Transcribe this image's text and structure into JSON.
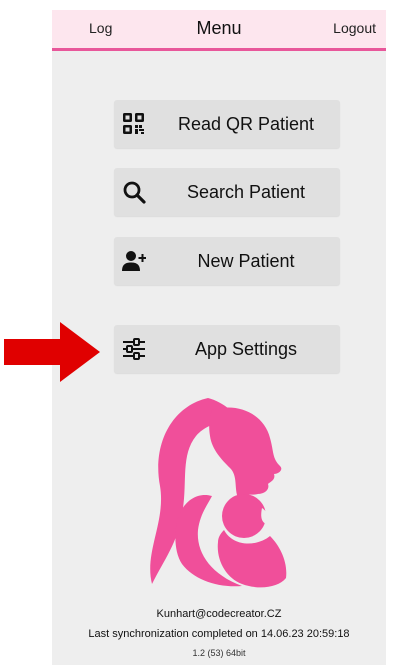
{
  "header": {
    "log_label": "Log",
    "title": "Menu",
    "logout_label": "Logout"
  },
  "menu": {
    "items": [
      {
        "label": "Read QR Patient",
        "icon": "qr-code-icon"
      },
      {
        "label": "Search Patient",
        "icon": "search-icon"
      },
      {
        "label": "New Patient",
        "icon": "add-person-icon"
      },
      {
        "label": "App Settings",
        "icon": "sliders-icon"
      }
    ]
  },
  "footer": {
    "email": "Kunhart@codecreator.CZ",
    "sync": "Last synchronization completed on 14.06.23 20:59:18",
    "version": "1.2 (53) 64bit"
  },
  "colors": {
    "header_bg": "#fde6ee",
    "accent": "#e8579a",
    "logo_pink": "#f04f9a",
    "arrow_red": "#e00000",
    "button_bg": "#e0e0e0"
  }
}
